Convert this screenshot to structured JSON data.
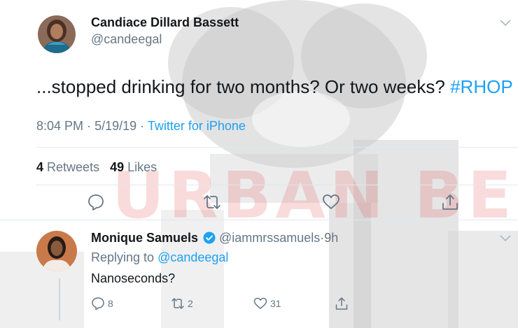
{
  "watermark": {
    "text": "URBAN BELLE"
  },
  "tweet": {
    "display_name": "Candiace Dillard Bassett",
    "handle": "@candeegal",
    "text": "...stopped drinking for two months? Or two weeks?",
    "hashtag": "#RHOP",
    "time": "8:04 PM",
    "date": "5/19/19",
    "separator": "·",
    "source": "Twitter for iPhone",
    "retweets_count": "4",
    "retweets_label": "Retweets",
    "likes_count": "49",
    "likes_label": "Likes",
    "actions": [
      "reply-icon",
      "retweet-icon",
      "heart-icon",
      "share-icon"
    ]
  },
  "reply": {
    "display_name": "Monique Samuels",
    "handle": "@iammrssamuels",
    "separator": "·",
    "age": "9h",
    "replying_prefix": "Replying to",
    "replying_to": "@candeegal",
    "text": "Nanoseconds?",
    "reply_count": "8",
    "retweet_count": "2",
    "like_count": "31",
    "verified": true
  },
  "colors": {
    "link": "#1da1f2",
    "secondary_text": "#657786",
    "primary_text": "#14171a",
    "divider": "#e1e8ed",
    "watermark": "#e45a60"
  }
}
